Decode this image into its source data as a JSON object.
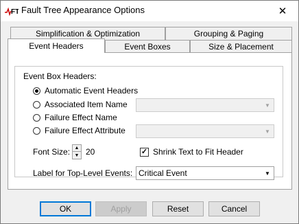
{
  "window": {
    "title": "Fault Tree Appearance Options",
    "close_glyph": "✕",
    "icon_text": "FT"
  },
  "tabs": {
    "row_back": [
      "Simplification & Optimization",
      "Grouping & Paging"
    ],
    "row_front": [
      "Event Headers",
      "Event Boxes",
      "Size & Placement"
    ],
    "active": "Event Headers"
  },
  "event_headers": {
    "group_label": "Event Box Headers:",
    "options": [
      {
        "label": "Automatic Event Headers",
        "checked": true
      },
      {
        "label": "Associated Item Name",
        "checked": false
      },
      {
        "label": "Failure Effect Name",
        "checked": false
      },
      {
        "label": "Failure Effect Attribute",
        "checked": false
      }
    ],
    "associated_item_combo": {
      "value": "",
      "enabled": false
    },
    "failure_attribute_combo": {
      "value": "",
      "enabled": false
    },
    "font_size_label": "Font Size:",
    "font_size_value": "20",
    "shrink_label": "Shrink Text to Fit Header",
    "shrink_checked": true,
    "top_level_label": "Label for Top-Level Events:",
    "top_level_value": "Critical Event"
  },
  "buttons": {
    "ok": "OK",
    "apply": "Apply",
    "reset": "Reset",
    "cancel": "Cancel"
  },
  "colors": {
    "accent": "#0078d7",
    "icon_red": "#cc0000"
  },
  "icons": {
    "arrow_down": "▼",
    "spin_up": "▲",
    "spin_down": "▼",
    "check": "✓"
  }
}
